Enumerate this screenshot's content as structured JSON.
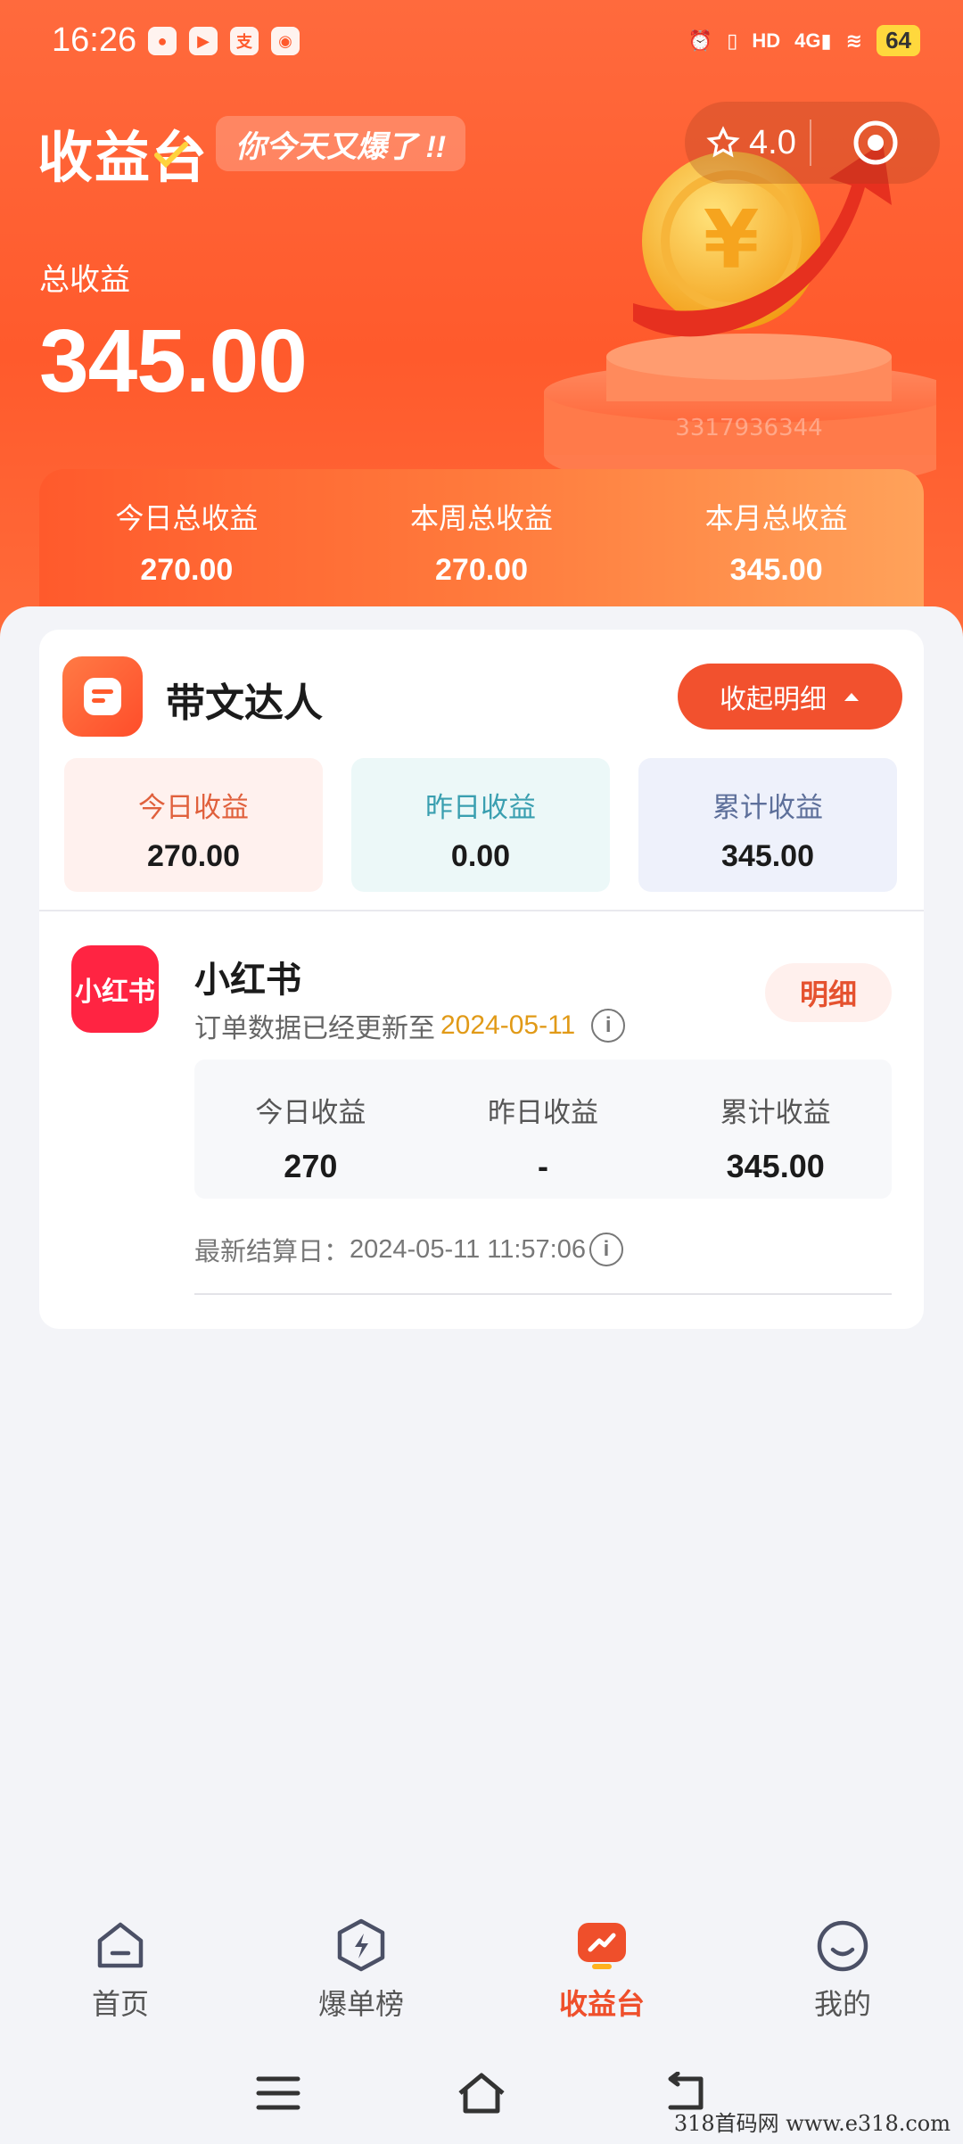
{
  "status": {
    "time": "16:26",
    "left_icons": [
      "wechat-icon",
      "video-app-icon",
      "alipay-icon",
      "map-app-icon"
    ],
    "right_icons": [
      "alarm-icon",
      "vibrate-icon",
      "hd-icon",
      "signal-4g-icon",
      "wifi-icon"
    ],
    "battery": "64"
  },
  "header": {
    "title": "收益台",
    "slogan": "你今天又爆了 !!",
    "rating": "4.0",
    "total_label": "总收益",
    "total_value": "345.00",
    "coin_watermark": "3317936344"
  },
  "periods": [
    {
      "label": "今日总收益",
      "value": "270.00"
    },
    {
      "label": "本周总收益",
      "value": "270.00"
    },
    {
      "label": "本月总收益",
      "value": "345.00"
    }
  ],
  "dawen": {
    "title": "带文达人",
    "collapse_label": "收起明细",
    "stats": [
      {
        "label": "今日收益",
        "value": "270.00"
      },
      {
        "label": "昨日收益",
        "value": "0.00"
      },
      {
        "label": "累计收益",
        "value": "345.00"
      }
    ]
  },
  "platform": {
    "logo_text": "小红书",
    "name": "小红书",
    "update_prefix": "订单数据已经更新至",
    "update_date": "2024-05-11",
    "detail_label": "明细",
    "stats": [
      {
        "label": "今日收益",
        "value": "270"
      },
      {
        "label": "昨日收益",
        "value": "-"
      },
      {
        "label": "累计收益",
        "value": "345.00"
      }
    ],
    "settle_label": "最新结算日：",
    "settle_time": "2024-05-11 11:57:06"
  },
  "tabs": [
    {
      "label": "首页",
      "icon": "home-icon"
    },
    {
      "label": "爆单榜",
      "icon": "lightning-hexagon-icon"
    },
    {
      "label": "收益台",
      "icon": "earnings-icon",
      "active": true
    },
    {
      "label": "我的",
      "icon": "smiley-icon"
    }
  ],
  "watermark": "318首码网  www.e318.com",
  "colors": {
    "accent": "#ef4f2b",
    "brand": "#ff5a2c",
    "highlight_date": "#e19a17"
  }
}
